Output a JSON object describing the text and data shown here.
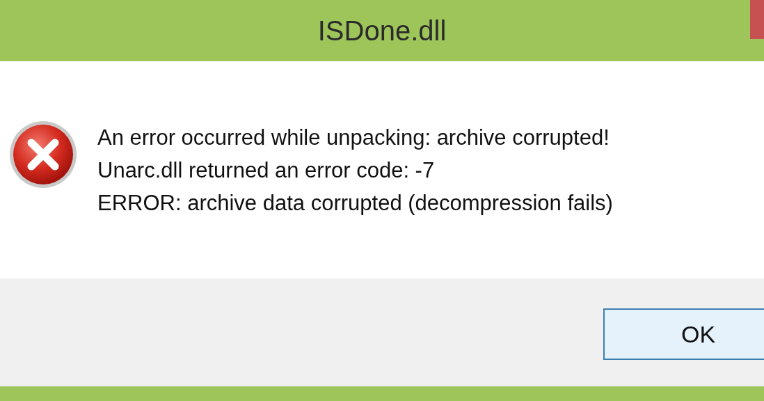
{
  "window": {
    "title": "ISDone.dll"
  },
  "message": {
    "lines": [
      "An error occurred while unpacking: archive corrupted!",
      "Unarc.dll returned an error code: -7",
      "ERROR: archive data corrupted (decompression fails)"
    ]
  },
  "buttons": [
    {
      "label": "OK",
      "kind": "default"
    }
  ]
}
